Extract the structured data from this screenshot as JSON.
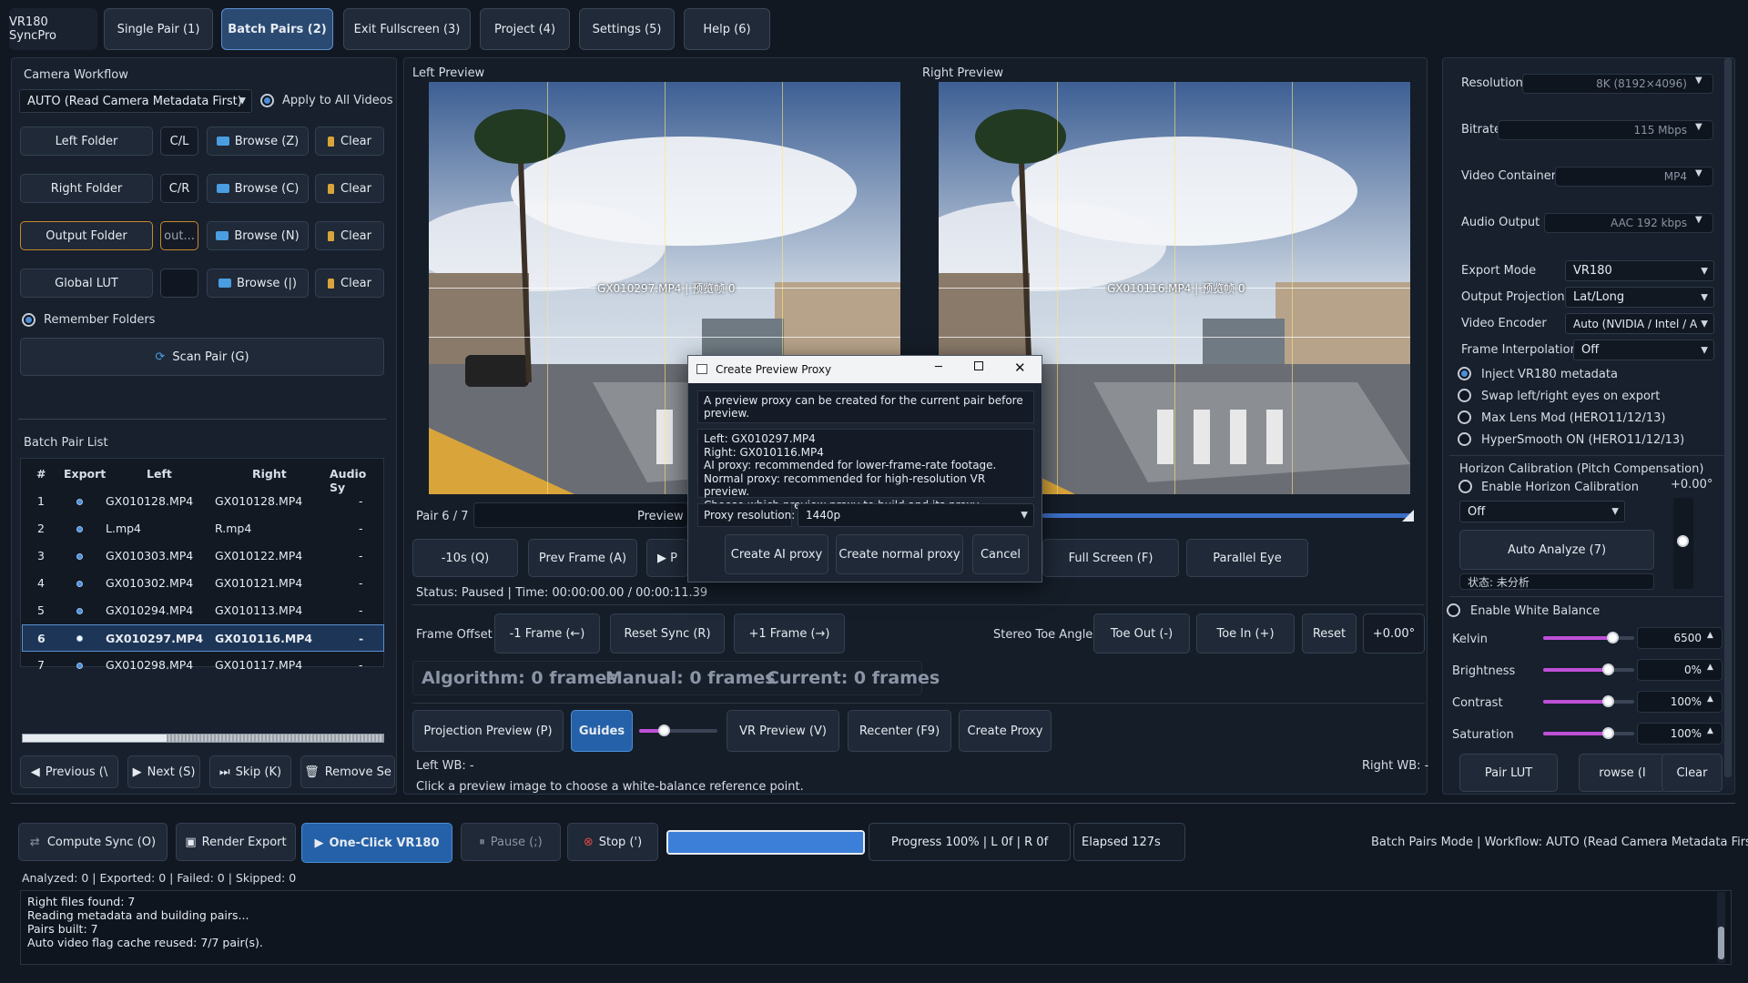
{
  "app": {
    "title": "VR180 SyncPro"
  },
  "tabs": [
    "Single Pair (1)",
    "Batch Pairs (2)",
    "Exit Fullscreen (3)",
    "Project (4)",
    "Settings (5)",
    "Help (6)"
  ],
  "left": {
    "workflow_title": "Camera Workflow",
    "workflow_value": "AUTO (Read Camera Metadata First)",
    "apply_all": "Apply to All Videos",
    "left_folder": "Left Folder",
    "left_code": "C/L",
    "browse_z": "Browse (Z)",
    "right_folder": "Right Folder",
    "right_code": "C/R",
    "browse_c": "Browse (C)",
    "output_folder": "Output Folder",
    "output_code": "out...",
    "browse_n": "Browse (N)",
    "global_lut": "Global LUT",
    "browse_j": "Browse (|)",
    "clear": "Clear",
    "remember": "Remember Folders",
    "scan": "Scan  Pair (G)",
    "list_title": "Batch Pair List",
    "headers": [
      "#",
      "Export",
      "Left",
      "Right",
      "Audio Sy"
    ],
    "rows": [
      {
        "n": "1",
        "left": "GX010128.MP4",
        "right": "GX010128.MP4",
        "audio": "-"
      },
      {
        "n": "2",
        "left": "L.mp4",
        "right": "R.mp4",
        "audio": "-"
      },
      {
        "n": "3",
        "left": "GX010303.MP4",
        "right": "GX010122.MP4",
        "audio": "-"
      },
      {
        "n": "4",
        "left": "GX010302.MP4",
        "right": "GX010121.MP4",
        "audio": "-"
      },
      {
        "n": "5",
        "left": "GX010294.MP4",
        "right": "GX010113.MP4",
        "audio": "-"
      },
      {
        "n": "6",
        "left": "GX010297.MP4",
        "right": "GX010116.MP4",
        "audio": "-"
      },
      {
        "n": "7",
        "left": "GX010298.MP4",
        "right": "GX010117.MP4",
        "audio": "-"
      }
    ],
    "nav": [
      "Previous (\\",
      "Next (S)",
      "Skip (K)",
      "Remove Se"
    ]
  },
  "center": {
    "left_preview": "Left Preview",
    "right_preview": "Right Preview",
    "left_overlay": "GX010297.MP4 | 预览帧 0",
    "right_overlay": "GX010116.MP4 | 预览帧 0",
    "pair": "Pair 6 / 7",
    "preview_f": "Preview F",
    "transport": [
      "-10s (Q)",
      "Prev Frame (A)",
      "▶ P",
      "Full Screen (F)",
      "Parallel Eye"
    ],
    "status": "Status: Paused | Time: 00:00:00.00 / 00:00:11.39",
    "frame_offset": "Frame Offset",
    "minus_frame": "-1 Frame (←)",
    "reset_sync": "Reset Sync (R)",
    "plus_frame": "+1 Frame (→)",
    "toe_angle": "Stereo Toe Angle",
    "toe_out": "Toe Out (-)",
    "toe_in": "Toe In (+)",
    "reset": "Reset",
    "toe_value": "+0.00°",
    "algorithm": "Algorithm: 0 frames",
    "manual": "Manual: 0 frames",
    "current": "Current: 0 frames",
    "projection": "Projection Preview (P)",
    "guides": "Guides",
    "vr_preview": "VR Preview (V)",
    "recenter": "Recenter (F9)",
    "create_proxy": "Create Proxy",
    "left_wb": "Left WB: -",
    "right_wb": "Right WB: -",
    "hint": "Click a preview image to choose a white-balance reference point."
  },
  "dialog": {
    "title": "Create Preview Proxy",
    "intro": "A preview proxy can be created for the current pair before preview.",
    "lines": [
      "Left: GX010297.MP4",
      "Right: GX010116.MP4",
      "AI proxy: recommended for lower-frame-rate footage.",
      "Normal proxy: recommended for high-resolution VR preview.",
      "Choose which preview proxy to build and its proxy resolution."
    ],
    "res_label": "Proxy resolution:",
    "res_value": "1440p",
    "ai": "Create AI proxy",
    "normal": "Create normal proxy",
    "cancel": "Cancel"
  },
  "right": {
    "resolution": "Resolution",
    "resolution_val": "8K (8192×4096)",
    "bitrate": "Bitrate",
    "bitrate_val": "115 Mbps",
    "container": "Video Container",
    "container_val": "MP4",
    "audio": "Audio Output",
    "audio_val": "AAC 192 kbps",
    "export_mode": "Export Mode",
    "export_mode_val": "VR180",
    "projection": "Output Projection",
    "projection_val": "Lat/Long",
    "encoder": "Video Encoder",
    "encoder_val": "Auto (NVIDIA / Intel / A",
    "interp": "Frame Interpolation",
    "interp_val": "Off",
    "inject": "Inject VR180 metadata",
    "swap": "Swap left/right eyes on export",
    "maxlens": "Max Lens Mod (HERO11/12/13)",
    "hypersmooth": "HyperSmooth ON (HERO11/12/13)",
    "horizon_title": "Horizon Calibration (Pitch Compensation)",
    "horizon_enable": "Enable Horizon Calibration",
    "horizon_val": "+0.00°",
    "horizon_mode": "Off",
    "auto_analyze": "Auto Analyze (7)",
    "state": "状态: 未分析",
    "wb_enable": "Enable White Balance",
    "kelvin": "Kelvin",
    "kelvin_val": "6500",
    "brightness": "Brightness",
    "brightness_val": "0%",
    "contrast": "Contrast",
    "contrast_val": "100%",
    "saturation": "Saturation",
    "saturation_val": "100%",
    "pair_lut": "Pair LUT",
    "browse": "rowse (I",
    "clear": "Clear"
  },
  "bottom": {
    "compute": "Compute Sync (O)",
    "render": "Render Export",
    "oneclick": "One-Click VR180",
    "pause": "Pause (;)",
    "stop": "Stop (')",
    "progress_pct": 100,
    "progress": "Progress 100% | L 0f | R 0f",
    "elapsed": "Elapsed 127s",
    "mode": "Batch Pairs Mode | Workflow: AUTO (Read Camera Metadata First)",
    "counts": "Analyzed: 0 | Exported: 0 | Failed: 0 | Skipped: 0",
    "log": [
      "Right files found: 7",
      "Reading metadata and building pairs...",
      "Pairs built: 7",
      "Auto video flag cache reused: 7/7 pair(s)."
    ]
  }
}
